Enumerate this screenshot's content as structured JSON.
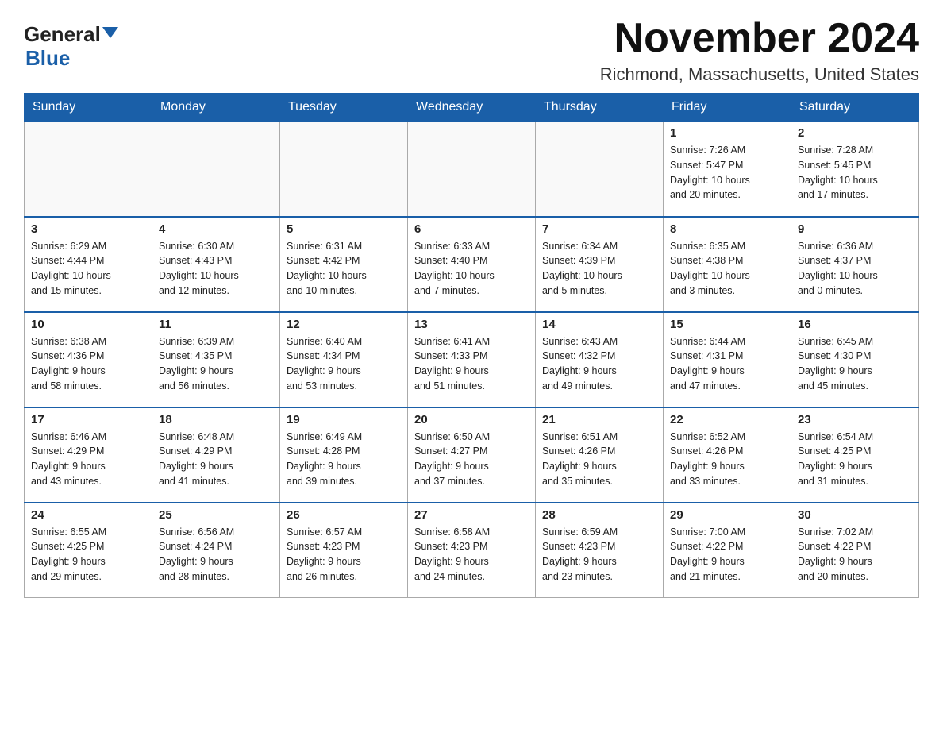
{
  "header": {
    "logo_general": "General",
    "logo_blue": "Blue",
    "month_title": "November 2024",
    "location": "Richmond, Massachusetts, United States"
  },
  "weekdays": [
    "Sunday",
    "Monday",
    "Tuesday",
    "Wednesday",
    "Thursday",
    "Friday",
    "Saturday"
  ],
  "weeks": [
    [
      {
        "day": "",
        "info": ""
      },
      {
        "day": "",
        "info": ""
      },
      {
        "day": "",
        "info": ""
      },
      {
        "day": "",
        "info": ""
      },
      {
        "day": "",
        "info": ""
      },
      {
        "day": "1",
        "info": "Sunrise: 7:26 AM\nSunset: 5:47 PM\nDaylight: 10 hours\nand 20 minutes."
      },
      {
        "day": "2",
        "info": "Sunrise: 7:28 AM\nSunset: 5:45 PM\nDaylight: 10 hours\nand 17 minutes."
      }
    ],
    [
      {
        "day": "3",
        "info": "Sunrise: 6:29 AM\nSunset: 4:44 PM\nDaylight: 10 hours\nand 15 minutes."
      },
      {
        "day": "4",
        "info": "Sunrise: 6:30 AM\nSunset: 4:43 PM\nDaylight: 10 hours\nand 12 minutes."
      },
      {
        "day": "5",
        "info": "Sunrise: 6:31 AM\nSunset: 4:42 PM\nDaylight: 10 hours\nand 10 minutes."
      },
      {
        "day": "6",
        "info": "Sunrise: 6:33 AM\nSunset: 4:40 PM\nDaylight: 10 hours\nand 7 minutes."
      },
      {
        "day": "7",
        "info": "Sunrise: 6:34 AM\nSunset: 4:39 PM\nDaylight: 10 hours\nand 5 minutes."
      },
      {
        "day": "8",
        "info": "Sunrise: 6:35 AM\nSunset: 4:38 PM\nDaylight: 10 hours\nand 3 minutes."
      },
      {
        "day": "9",
        "info": "Sunrise: 6:36 AM\nSunset: 4:37 PM\nDaylight: 10 hours\nand 0 minutes."
      }
    ],
    [
      {
        "day": "10",
        "info": "Sunrise: 6:38 AM\nSunset: 4:36 PM\nDaylight: 9 hours\nand 58 minutes."
      },
      {
        "day": "11",
        "info": "Sunrise: 6:39 AM\nSunset: 4:35 PM\nDaylight: 9 hours\nand 56 minutes."
      },
      {
        "day": "12",
        "info": "Sunrise: 6:40 AM\nSunset: 4:34 PM\nDaylight: 9 hours\nand 53 minutes."
      },
      {
        "day": "13",
        "info": "Sunrise: 6:41 AM\nSunset: 4:33 PM\nDaylight: 9 hours\nand 51 minutes."
      },
      {
        "day": "14",
        "info": "Sunrise: 6:43 AM\nSunset: 4:32 PM\nDaylight: 9 hours\nand 49 minutes."
      },
      {
        "day": "15",
        "info": "Sunrise: 6:44 AM\nSunset: 4:31 PM\nDaylight: 9 hours\nand 47 minutes."
      },
      {
        "day": "16",
        "info": "Sunrise: 6:45 AM\nSunset: 4:30 PM\nDaylight: 9 hours\nand 45 minutes."
      }
    ],
    [
      {
        "day": "17",
        "info": "Sunrise: 6:46 AM\nSunset: 4:29 PM\nDaylight: 9 hours\nand 43 minutes."
      },
      {
        "day": "18",
        "info": "Sunrise: 6:48 AM\nSunset: 4:29 PM\nDaylight: 9 hours\nand 41 minutes."
      },
      {
        "day": "19",
        "info": "Sunrise: 6:49 AM\nSunset: 4:28 PM\nDaylight: 9 hours\nand 39 minutes."
      },
      {
        "day": "20",
        "info": "Sunrise: 6:50 AM\nSunset: 4:27 PM\nDaylight: 9 hours\nand 37 minutes."
      },
      {
        "day": "21",
        "info": "Sunrise: 6:51 AM\nSunset: 4:26 PM\nDaylight: 9 hours\nand 35 minutes."
      },
      {
        "day": "22",
        "info": "Sunrise: 6:52 AM\nSunset: 4:26 PM\nDaylight: 9 hours\nand 33 minutes."
      },
      {
        "day": "23",
        "info": "Sunrise: 6:54 AM\nSunset: 4:25 PM\nDaylight: 9 hours\nand 31 minutes."
      }
    ],
    [
      {
        "day": "24",
        "info": "Sunrise: 6:55 AM\nSunset: 4:25 PM\nDaylight: 9 hours\nand 29 minutes."
      },
      {
        "day": "25",
        "info": "Sunrise: 6:56 AM\nSunset: 4:24 PM\nDaylight: 9 hours\nand 28 minutes."
      },
      {
        "day": "26",
        "info": "Sunrise: 6:57 AM\nSunset: 4:23 PM\nDaylight: 9 hours\nand 26 minutes."
      },
      {
        "day": "27",
        "info": "Sunrise: 6:58 AM\nSunset: 4:23 PM\nDaylight: 9 hours\nand 24 minutes."
      },
      {
        "day": "28",
        "info": "Sunrise: 6:59 AM\nSunset: 4:23 PM\nDaylight: 9 hours\nand 23 minutes."
      },
      {
        "day": "29",
        "info": "Sunrise: 7:00 AM\nSunset: 4:22 PM\nDaylight: 9 hours\nand 21 minutes."
      },
      {
        "day": "30",
        "info": "Sunrise: 7:02 AM\nSunset: 4:22 PM\nDaylight: 9 hours\nand 20 minutes."
      }
    ]
  ]
}
